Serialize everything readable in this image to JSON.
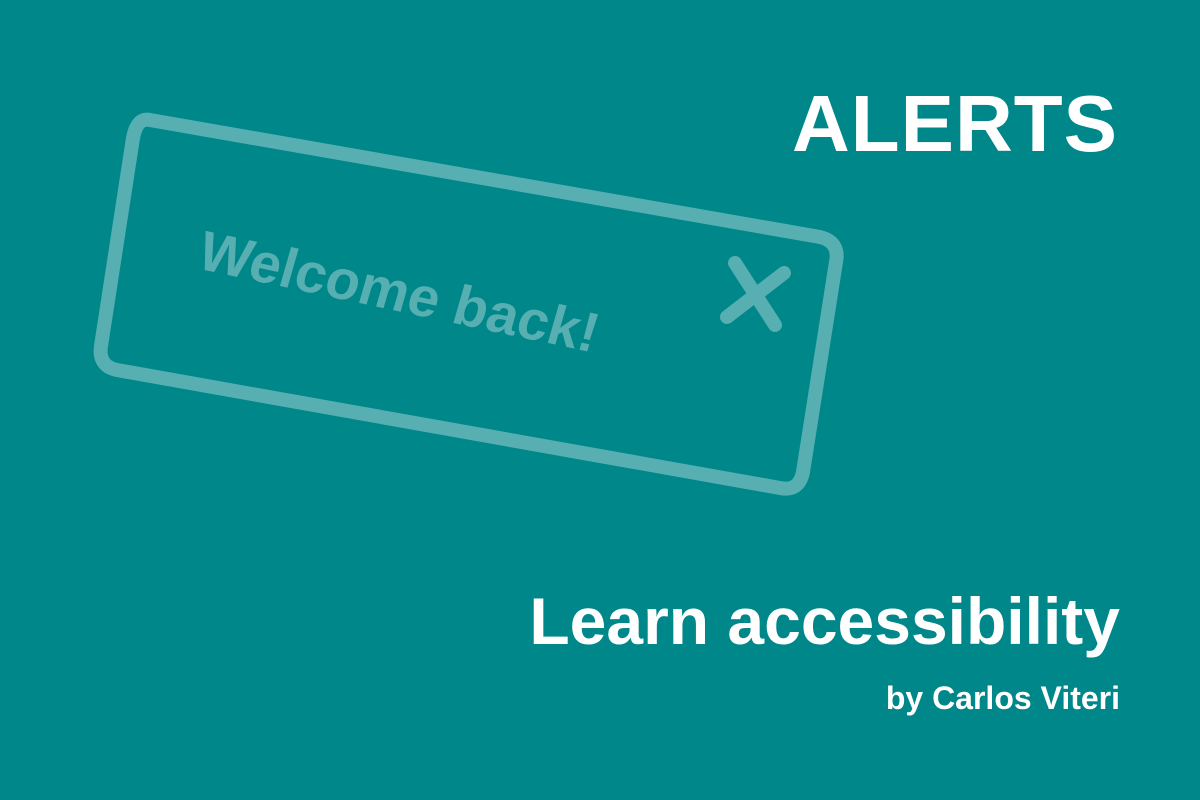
{
  "title": "ALERTS",
  "alert_illustration": {
    "message": "Welcome back!",
    "close_icon": "close-icon",
    "outline_color": "#57AFB2"
  },
  "subtitle": "Learn accessibility",
  "byline": "by Carlos Viteri",
  "colors": {
    "background": "#00878A",
    "text": "#FFFFFF"
  }
}
